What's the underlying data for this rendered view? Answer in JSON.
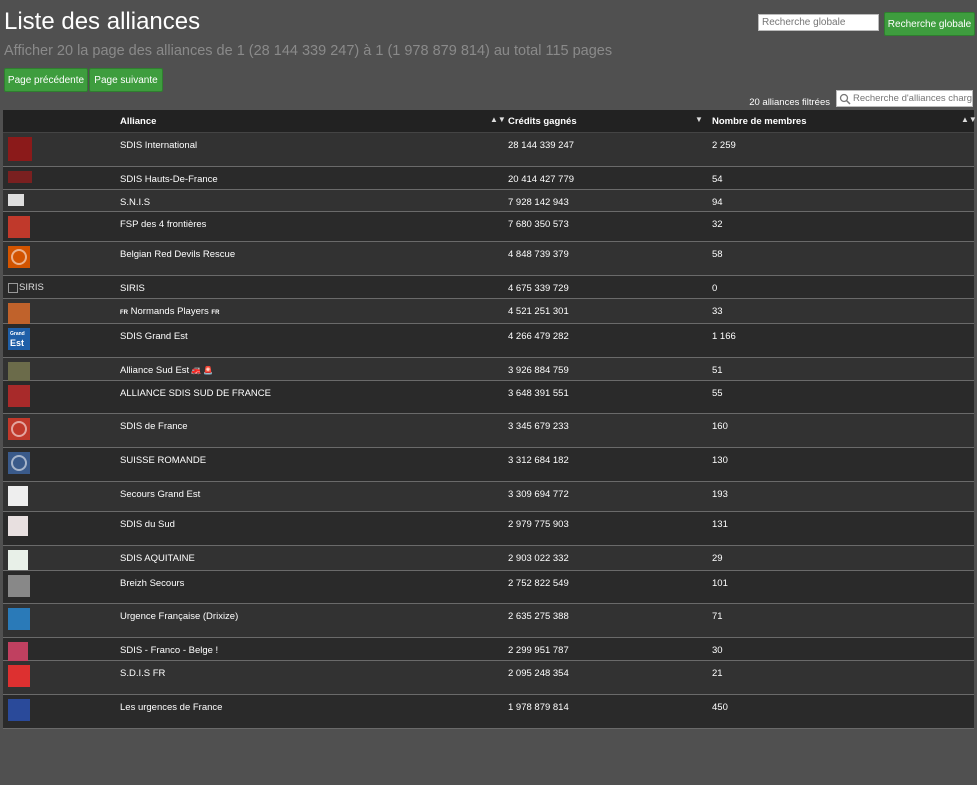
{
  "page": {
    "title": "Liste des alliances",
    "subtitle": "Afficher 20 la page des alliances de 1 (28 144 339 247) à 1 (1 978 879 814) au total 115 pages"
  },
  "global_search": {
    "placeholder": "Recherche globale",
    "button": "Recherche globale"
  },
  "pager": {
    "prev": "Page précédente",
    "next": "Page suivante"
  },
  "filter": {
    "count_text": "20 alliances filtrées",
    "placeholder": "Recherche d'alliances chargées"
  },
  "table": {
    "headers": {
      "alliance": "Alliance",
      "credits": "Crédits gagnés",
      "members": "Nombre de membres"
    },
    "rows": [
      {
        "name": "SDIS International",
        "credits": "28 144 339 247",
        "members": "2 259",
        "logo_color": "#8b1a1a"
      },
      {
        "name": "SDIS Hauts-De-France",
        "credits": "20 414 427 779",
        "members": "54",
        "logo_color": "#7a2020"
      },
      {
        "name": "S.N.I.S",
        "credits": "7 928 142 943",
        "members": "94",
        "logo_color": "#dddddd"
      },
      {
        "name": "FSP des 4 frontières",
        "credits": "7 680 350 573",
        "members": "32",
        "logo_color": "#c0392b"
      },
      {
        "name": "Belgian Red Devils Rescue",
        "credits": "4 848 739 379",
        "members": "58",
        "logo_color": "#d35400"
      },
      {
        "name": "SIRIS",
        "credits": "4 675 339 729",
        "members": "0",
        "logo_alt": "SIRIS"
      },
      {
        "name": "Normands Players",
        "name_prefix": "FR",
        "name_suffix": "FR",
        "credits": "4 521 251 301",
        "members": "33",
        "logo_color": "#c0622b"
      },
      {
        "name": "SDIS Grand Est",
        "credits": "4 266 479 282",
        "members": "1 166",
        "logo_color": "#1f5fa8",
        "logo_text": [
          "Grand",
          "Est"
        ]
      },
      {
        "name": "Alliance Sud Est",
        "name_icons": [
          "🚒",
          "🚨"
        ],
        "credits": "3 926 884 759",
        "members": "51",
        "logo_color": "#6b6b4a"
      },
      {
        "name": "ALLIANCE SDIS SUD DE FRANCE",
        "credits": "3 648 391 551",
        "members": "55",
        "logo_color": "#a82a2a"
      },
      {
        "name": "SDIS de France",
        "credits": "3 345 679 233",
        "members": "160",
        "logo_color": "#c0392b"
      },
      {
        "name": "SUISSE ROMANDE",
        "credits": "3 312 684 182",
        "members": "130",
        "logo_color": "#3a5a8a"
      },
      {
        "name": "Secours Grand Est",
        "credits": "3 309 694 772",
        "members": "193",
        "logo_color": "#eeeeee"
      },
      {
        "name": "SDIS du Sud",
        "credits": "2 979 775 903",
        "members": "131",
        "logo_color": "#e8e0e0"
      },
      {
        "name": "SDIS AQUITAINE",
        "credits": "2 903 022 332",
        "members": "29",
        "logo_color": "#e8f0e8"
      },
      {
        "name": "Breizh Secours",
        "credits": "2 752 822 549",
        "members": "101",
        "logo_color": "#888888"
      },
      {
        "name": "Urgence Française (Drixize)",
        "credits": "2 635 275 388",
        "members": "71",
        "logo_color": "#2a7ab8"
      },
      {
        "name": "SDIS - Franco - Belge !",
        "credits": "2 299 951 787",
        "members": "30",
        "logo_color": "#c04060"
      },
      {
        "name": "S.D.I.S FR",
        "credits": "2 095 248 354",
        "members": "21",
        "logo_color": "#dd3030"
      },
      {
        "name": "Les urgences de France",
        "credits": "1 978 879 814",
        "members": "450",
        "logo_color": "#2a4a9a"
      }
    ]
  }
}
